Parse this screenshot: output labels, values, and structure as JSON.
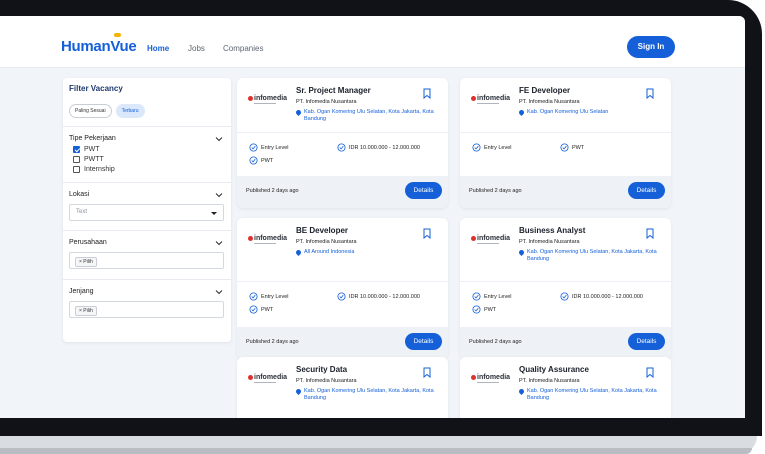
{
  "nav": {
    "logo": "HumanVue",
    "links": [
      "Home",
      "Jobs",
      "Companies"
    ],
    "sign_in": "Sign In"
  },
  "filter": {
    "title": "Filter Vacancy",
    "sort_options": [
      "Paling Sesuai",
      "Terbaru"
    ],
    "sort_selected": "Terbaru",
    "job_type_title": "Tipe Pekerjaan",
    "job_types": [
      {
        "label": "PWT",
        "checked": true
      },
      {
        "label": "PWTT",
        "checked": false
      },
      {
        "label": "Internship",
        "checked": false
      }
    ],
    "location_title": "Lokasi",
    "location_placeholder": "Text",
    "company_title": "Perusahaan",
    "company_tag": "× Pilih",
    "level_title": "Jenjang",
    "level_tag": "× Pilih"
  },
  "jobs": [
    {
      "brand": "infomedia",
      "title": "Sr. Project Manager",
      "company": "PT. Infomedia Nusantara",
      "location": "Kab. Ogan Komering Ulu Selatan, Kota Jakarta, Kota Bandung",
      "level": "Entry Level",
      "salary": "IDR 10.000.000 - 12.000.000",
      "type": "PWT",
      "published": "Published 2 days ago",
      "details": "Details"
    },
    {
      "brand": "infomedia",
      "title": "FE Developer",
      "company": "PT. Infomedia Nusantara",
      "location": "Kab. Ogan Komering Ulu Selatan",
      "level": "Entry Level",
      "salary": "",
      "type": "PWT",
      "published": "Published 2 days ago",
      "details": "Details"
    },
    {
      "brand": "infomedia",
      "title": "BE Developer",
      "company": "PT. Infomedia Nusantara",
      "location": "All Around Indonesia",
      "level": "Entry Level",
      "salary": "IDR 10.000.000 - 12.000.000",
      "type": "PWT",
      "published": "Published 2 days ago",
      "details": "Details"
    },
    {
      "brand": "infomedia",
      "title": "Business Analyst",
      "company": "PT. Infomedia Nusantara",
      "location": "Kab. Ogan Komering Ulu Selatan, Kota Jakarta, Kota Bandung",
      "level": "Entry Level",
      "salary": "IDR 10.000.000 - 12.000.000",
      "type": "PWT",
      "published": "Published 2 days ago",
      "details": "Details"
    },
    {
      "brand": "infomedia",
      "title": "Security Data",
      "company": "PT. Infomedia Nusantara",
      "location": "Kab. Ogan Komering Ulu Selatan, Kota Jakarta, Kota Bandung"
    },
    {
      "brand": "infomedia",
      "title": "Quality Assurance",
      "company": "PT. Infomedia Nusantara",
      "location": "Kab. Ogan Komering Ulu Selatan, Kota Jakarta, Kota Bandung"
    }
  ],
  "colors": {
    "primary": "#1560d8",
    "background": "#f1f4f8",
    "brand_red": "#e0302a"
  }
}
